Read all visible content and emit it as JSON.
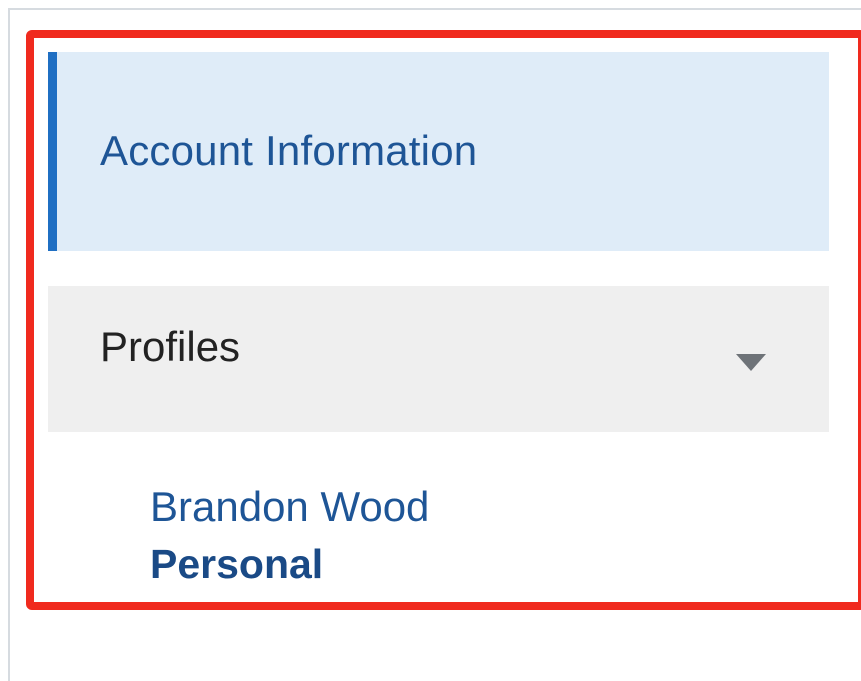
{
  "nav": {
    "account_information": "Account Information",
    "profiles": {
      "label": "Profiles",
      "chevron_icon": "triangle-down",
      "items": [
        {
          "name": "Brandon Wood",
          "type": "Personal"
        }
      ]
    }
  },
  "colors": {
    "active_bg": "#dfecf8",
    "active_accent": "#1f6fc3",
    "link_text": "#1e5596",
    "section_bg": "#efefef",
    "highlight_frame": "#f02a1e"
  }
}
